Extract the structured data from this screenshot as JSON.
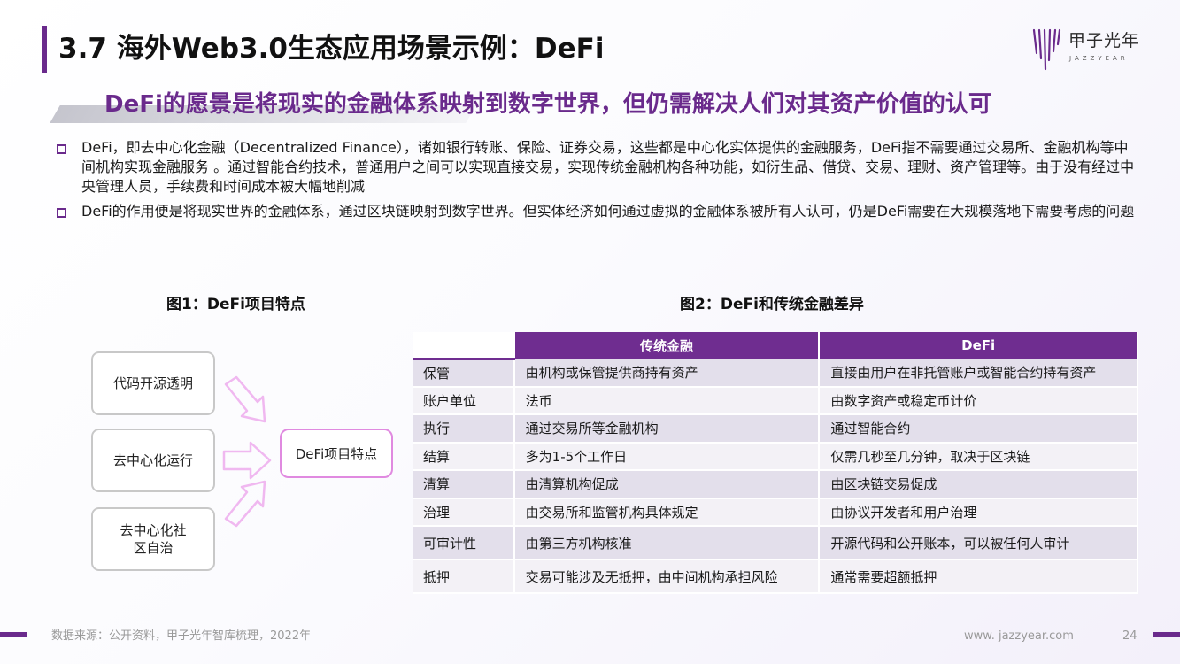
{
  "header": {
    "title": "3.7 海外Web3.0生态应用场景示例：DeFi",
    "logo_cn": "甲子光年",
    "logo_en": "JAZZYEAR"
  },
  "subtitle": "DeFi的愿景是将现实的金融体系映射到数字世界，但仍需解决人们对其资产价值的认可",
  "bullets": [
    "DeFi，即去中心化金融（Decentralized Finance），诸如银行转账、保险、证券交易，这些都是中心化实体提供的金融服务，DeFi指不需要通过交易所、金融机构等中间机构实现金融服务 。通过智能合约技术，普通用户之间可以实现直接交易，实现传统金融机构各种功能，如衍生品、借贷、交易、理财、资产管理等。由于没有经过中央管理人员，手续费和时间成本被大幅地削减",
    "DeFi的作用便是将现实世界的金融体系，通过区块链映射到数字世界。但实体经济如何通过虚拟的金融体系被所有人认可，仍是DeFi需要在大规模落地下需要考虑的问题"
  ],
  "fig1": {
    "title": "图1：DeFi项目特点",
    "features": [
      "代码开源透明",
      "去中心化运行",
      "去中心化社\n区自治"
    ],
    "center": "DeFi项目特点"
  },
  "fig2": {
    "title": "图2：DeFi和传统金融差异",
    "headers": [
      "",
      "传统金融",
      "DeFi"
    ],
    "rows": [
      [
        "保管",
        "由机构或保管提供商持有资产",
        "直接由用户在非托管账户或智能合约持有资产"
      ],
      [
        "账户单位",
        "法币",
        "由数字资产或稳定币计价"
      ],
      [
        "执行",
        "通过交易所等金融机构",
        "通过智能合约"
      ],
      [
        "结算",
        "多为1-5个工作日",
        "仅需几秒至几分钟，取决于区块链"
      ],
      [
        "清算",
        "由清算机构促成",
        "由区块链交易促成"
      ],
      [
        "治理",
        "由交易所和监管机构具体规定",
        "由协议开发者和用户治理"
      ],
      [
        "可审计性",
        "由第三方机构核准",
        "开源代码和公开账本，可以被任何人审计"
      ],
      [
        "抵押",
        "交易可能涉及无抵押，由中间机构承担风险",
        "通常需要超额抵押"
      ]
    ]
  },
  "footer": {
    "source": "数据来源：公开资料，甲子光年智库梳理，2022年",
    "url": "www. jazzyear.com",
    "page": "24"
  },
  "colors": {
    "accent": "#6a2a8c",
    "table_header": "#6f2d90",
    "row_odd": "#e3dfeb",
    "row_even": "#f3f1f6",
    "arrow_pink": "#f0b8f0"
  }
}
